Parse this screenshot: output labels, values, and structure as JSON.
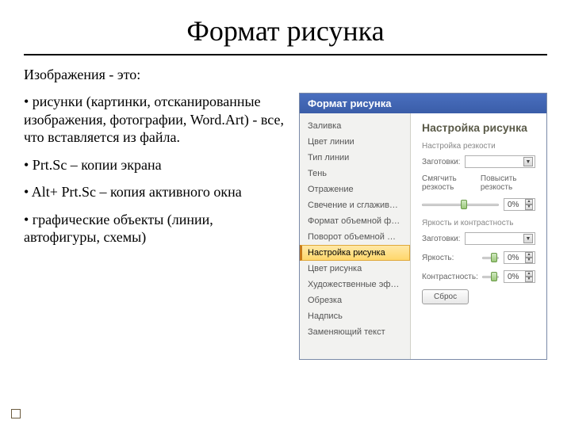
{
  "title": "Формат рисунка",
  "subtitle": "Изображения - это:",
  "bullets": [
    "• рисунки (картинки, отсканированные изображения, фотографии, Word.Art) - все, что вставляется из файла.",
    "• Prt.Sc – копии экрана",
    "• Alt+ Prt.Sc – копия активного окна",
    "• графические объекты (линии, автофигуры, схемы)"
  ],
  "dialog": {
    "title": "Формат рисунка",
    "sidebar": [
      "Заливка",
      "Цвет линии",
      "Тип линии",
      "Тень",
      "Отражение",
      "Свечение и сглаживание",
      "Формат объемной фигуры",
      "Поворот объемной фигуры",
      "Настройка рисунка",
      "Цвет рисунка",
      "Художественные эффекты",
      "Обрезка",
      "Надпись",
      "Заменяющий текст"
    ],
    "activeIndex": 8,
    "main": {
      "heading": "Настройка рисунка",
      "group1": "Настройка резкости",
      "preset": "Заготовки:",
      "softLabel": "Смягчить резкость",
      "sharpLabel": "Повысить резкость",
      "pct0": "0%",
      "group2": "Яркость и контрастность",
      "preset2": "Заготовки:",
      "brightness": "Яркость:",
      "contrast": "Контрастность:",
      "reset": "Сброс"
    }
  }
}
